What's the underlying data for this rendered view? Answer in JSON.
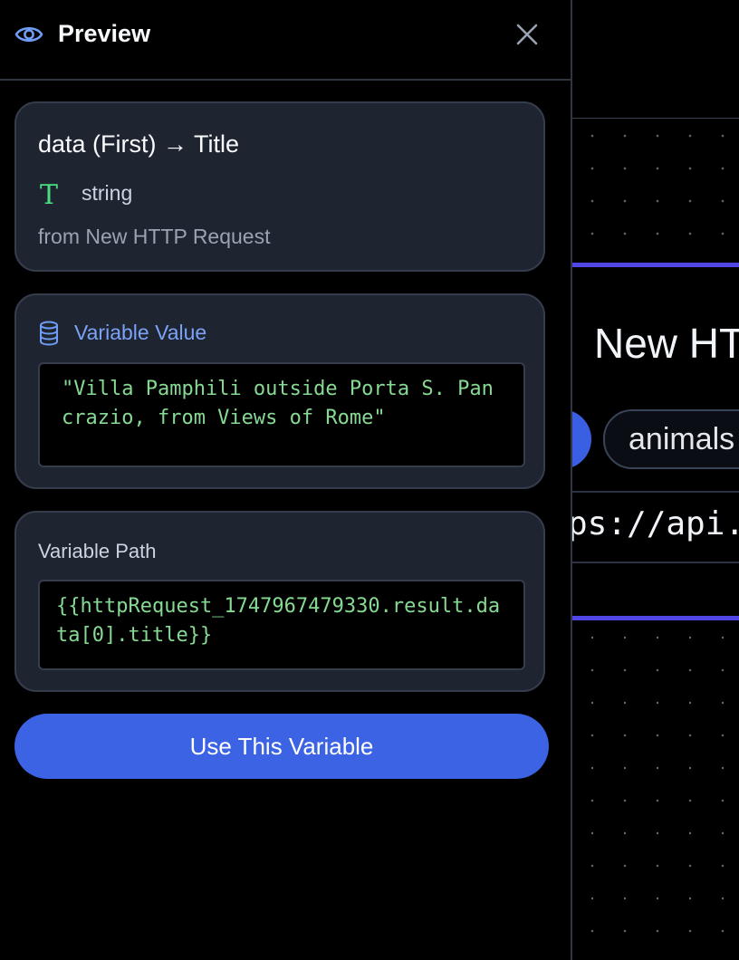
{
  "panel": {
    "title": "Preview",
    "icon": "eye-icon",
    "close_icon": "close-icon"
  },
  "variable": {
    "name": "data (First) → Title",
    "type_icon_glyph": "T",
    "type": "string",
    "source": "from New HTTP Request"
  },
  "value_section": {
    "title": "Variable Value",
    "icon": "database-icon",
    "value": "\"Villa Pamphili outside Porta S. Pancrazio, from Views of Rome\""
  },
  "path_section": {
    "title": "Variable Path",
    "path": "{{httpRequest_1747967479330.result.data[0].title}}"
  },
  "actions": {
    "use_button": "Use This Variable"
  },
  "canvas": {
    "node_title": "New HT",
    "tag_label": "animals",
    "url_fragment": "ps://api."
  },
  "colors": {
    "accent": "#3b63e3",
    "code_text": "#86d993",
    "link_blue": "#7aa2f7",
    "node_accent": "#4f46e5"
  }
}
